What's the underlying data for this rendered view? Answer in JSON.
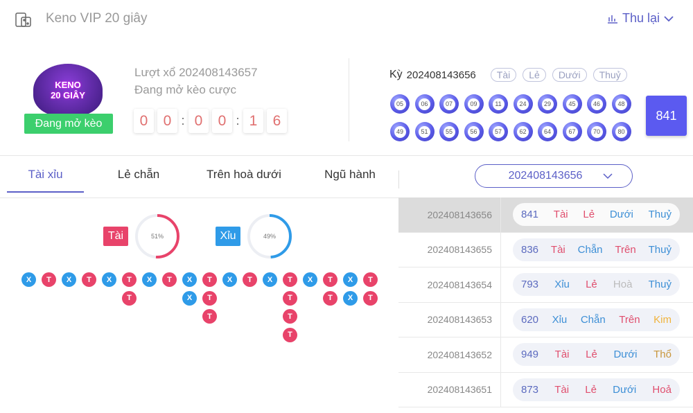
{
  "header": {
    "title": "Keno VIP 20 giây",
    "reload_label": "Thu lại"
  },
  "logo": {
    "line1": "KENO",
    "line2": "20 GIÂY"
  },
  "current": {
    "status_badge": "Đang mở kèo",
    "round_label": "Lượt xổ 202408143657",
    "round_status": "Đang mở kèo cược",
    "timer": [
      "0",
      "0",
      "0",
      "0",
      "1",
      "6"
    ]
  },
  "last": {
    "label": "Kỳ",
    "period": "202408143656",
    "tags": [
      "Tài",
      "Lẻ",
      "Dưới",
      "Thuỷ"
    ],
    "balls": [
      "05",
      "06",
      "07",
      "09",
      "11",
      "24",
      "29",
      "45",
      "46",
      "48",
      "49",
      "51",
      "55",
      "56",
      "57",
      "62",
      "64",
      "67",
      "70",
      "80"
    ],
    "sum": "841"
  },
  "tabs": [
    {
      "label": "Tài xỉu",
      "active": true
    },
    {
      "label": "Lẻ chẵn"
    },
    {
      "label": "Trên hoà dưới"
    },
    {
      "label": "Ngũ hành"
    }
  ],
  "period_select": {
    "value": "202408143656"
  },
  "stats": {
    "tai": {
      "label": "Tài",
      "percent": 51,
      "text": "51%",
      "color": "#e8436a"
    },
    "xiu": {
      "label": "Xỉu",
      "percent": 49,
      "text": "49%",
      "color": "#2f9be8"
    }
  },
  "road": [
    [
      "X"
    ],
    [
      "T"
    ],
    [
      "X"
    ],
    [
      "T"
    ],
    [
      "X"
    ],
    [
      "T",
      "T"
    ],
    [
      "X"
    ],
    [
      "T"
    ],
    [
      "X",
      "X"
    ],
    [
      "T",
      "T",
      "T"
    ],
    [
      "X"
    ],
    [
      "T"
    ],
    [
      "X"
    ],
    [
      "T",
      "T",
      "T",
      "T"
    ],
    [
      "X"
    ],
    [
      "T",
      "T"
    ],
    [
      "X",
      "X"
    ],
    [
      "T",
      "T"
    ]
  ],
  "history": [
    {
      "id": "202408143656",
      "sum": "841",
      "res": [
        "Tài",
        "Lẻ",
        "Dưới",
        "Thuỷ"
      ],
      "selected": true
    },
    {
      "id": "202408143655",
      "sum": "836",
      "res": [
        "Tài",
        "Chẵn",
        "Trên",
        "Thuỷ"
      ]
    },
    {
      "id": "202408143654",
      "sum": "793",
      "res": [
        "Xỉu",
        "Lẻ",
        "Hoà",
        "Thuỷ"
      ]
    },
    {
      "id": "202408143653",
      "sum": "620",
      "res": [
        "Xỉu",
        "Chẵn",
        "Trên",
        "Kim"
      ]
    },
    {
      "id": "202408143652",
      "sum": "949",
      "res": [
        "Tài",
        "Lẻ",
        "Dưới",
        "Thổ"
      ]
    },
    {
      "id": "202408143651",
      "sum": "873",
      "res": [
        "Tài",
        "Lẻ",
        "Dưới",
        "Hoả"
      ]
    }
  ],
  "colors": {
    "accent": "#5b5fc7",
    "red": "#e8436a",
    "blue": "#2f9be8",
    "sum_text": "#5b6abf",
    "Tài": "#e04f6e",
    "Lẻ": "#e04f6e",
    "Trên": "#e04f6e",
    "Hoả": "#e04f6e",
    "Xỉu": "#3d8fd6",
    "Chẵn": "#3d8fd6",
    "Dưới": "#3d8fd6",
    "Thuỷ": "#3d8fd6",
    "Hoà": "#bbbbbb",
    "Kim": "#f0b33c",
    "Thổ": "#c8963c"
  }
}
